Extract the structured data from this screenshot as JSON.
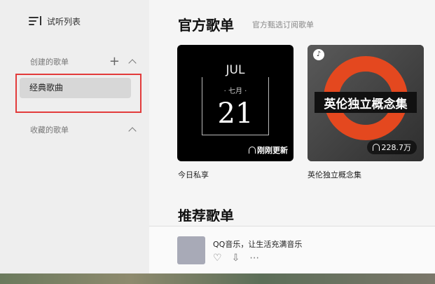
{
  "sidebar": {
    "listen_list_label": "试听列表",
    "created_section": "创建的歌单",
    "created_items": [
      "经典歌曲"
    ],
    "collected_section": "收藏的歌单"
  },
  "main": {
    "official_title": "官方歌单",
    "official_subtitle": "官方甄选订阅歌单",
    "cards": [
      {
        "name": "今日私享",
        "month": "JUL",
        "cn_month": "· 七月 ·",
        "day": "21",
        "badge": "刚刚更新"
      },
      {
        "name": "英伦独立概念集",
        "cover_text": "英伦独立概念集",
        "play_count": "228.7万"
      }
    ],
    "recommend_title": "推荐歌单",
    "song_row": {
      "text": "QQ音乐，让生活充满音乐"
    }
  },
  "colors": {
    "highlight": "#e23b3b",
    "ring": "#e4481f"
  }
}
